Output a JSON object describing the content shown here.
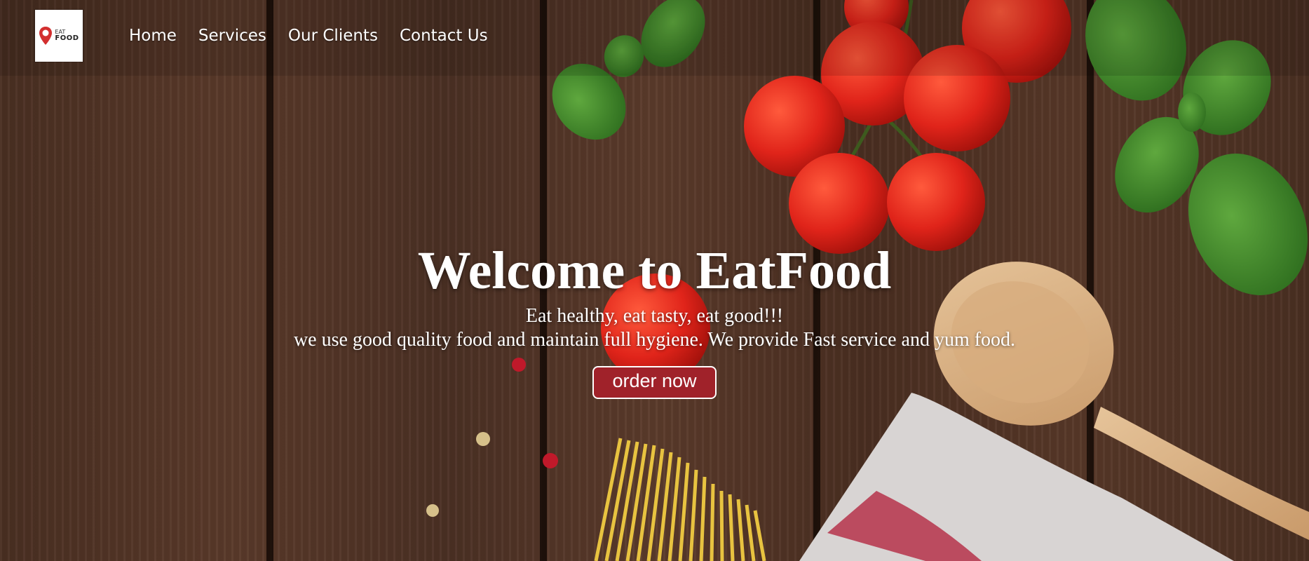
{
  "logo": {
    "brand_small": "EAT",
    "brand_large": "FOOD",
    "accent": "#d32f2f"
  },
  "nav": {
    "items": [
      {
        "label": "Home"
      },
      {
        "label": "Services"
      },
      {
        "label": "Our Clients"
      },
      {
        "label": "Contact Us"
      }
    ]
  },
  "hero": {
    "title": "Welcome to EatFood",
    "tagline": "Eat healthy, eat tasty, eat good!!!",
    "description": "we use good quality food and maintain full hygiene. We provide Fast service and yum food.",
    "cta_label": "order now",
    "cta_color": "#a0222a"
  }
}
